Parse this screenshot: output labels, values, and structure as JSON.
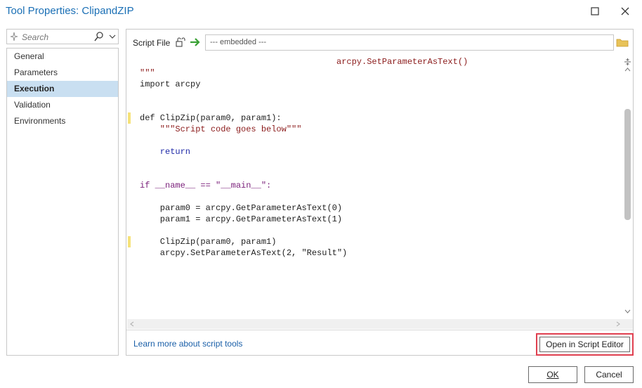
{
  "window": {
    "title": "Tool Properties: ClipandZIP"
  },
  "search": {
    "placeholder": "Search"
  },
  "nav": {
    "items": [
      {
        "label": "General"
      },
      {
        "label": "Parameters"
      },
      {
        "label": "Execution",
        "active": true
      },
      {
        "label": "Validation"
      },
      {
        "label": "Environments"
      }
    ]
  },
  "script_file": {
    "label": "Script File",
    "value": "--- embedded ---"
  },
  "code_lines": [
    "arcpy.SetParameterAsText()",
    "\"\"\"",
    "import arcpy",
    "",
    "def ClipZip(param0, param1):",
    "    \"\"\"Script code goes below\"\"\"",
    "",
    "    return",
    "",
    "",
    "if __name__ == \"__main__\":",
    "",
    "    param0 = arcpy.GetParameterAsText(0)",
    "    param1 = arcpy.GetParameterAsText(1)",
    "",
    "    ClipZip(param0, param1)",
    "    arcpy.SetParameterAsText(2, \"Result\")"
  ],
  "footer": {
    "learn_link": "Learn more about script tools",
    "open_editor_label": "Open in Script Editor"
  },
  "buttons": {
    "ok": "OK",
    "cancel": "Cancel"
  },
  "colors": {
    "title": "#1a6fb5",
    "active_nav_bg": "#c9dff1",
    "highlight_border": "#e04050",
    "change_marker": "#f6e27a",
    "keyword": "#1f2aa8",
    "string": "#8b1b1b"
  },
  "icons": {
    "maximize": "maximize-icon",
    "close": "close-icon",
    "search": "search-icon",
    "dropdown": "chevron-down-icon",
    "lock": "lock-icon",
    "import": "arrow-right-icon",
    "browse": "folder-icon"
  }
}
